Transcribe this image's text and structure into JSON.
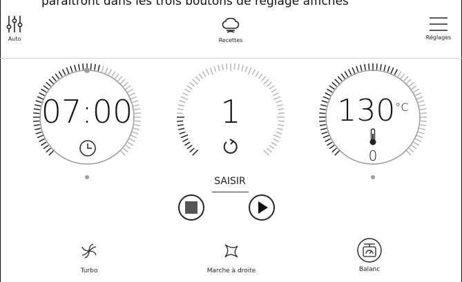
{
  "caption": "paraîtront dans les trois boutons de réglage affichés",
  "header": {
    "auto_label": "Auto",
    "recipes_label": "Recettes",
    "settings_label": "Réglages"
  },
  "dials": {
    "timer": {
      "value": "07:00",
      "level": 0.55
    },
    "speed": {
      "value": "1",
      "level": 0.18
    },
    "temperature": {
      "value": "130",
      "unit": "°C",
      "sub_value": "0",
      "level": 0.6
    }
  },
  "controls": {
    "saisir_label": "SAISIR"
  },
  "bottom": {
    "turbo_label": "Turbo",
    "direction_label": "Marche à droite",
    "balance_label": "Balanc"
  },
  "colors": {
    "accent": "#9e9e9e",
    "text": "#111111"
  }
}
